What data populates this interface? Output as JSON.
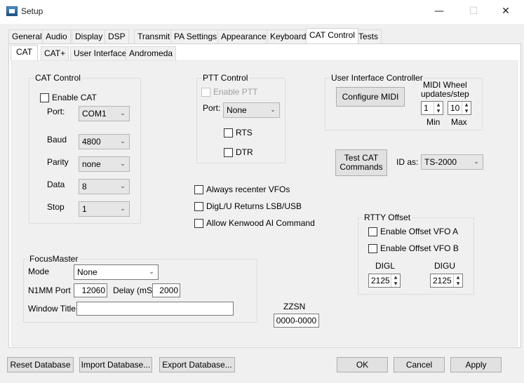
{
  "window": {
    "title": "Setup",
    "minimize_icon": "—",
    "maximize_icon": "☐",
    "close_icon": "✕"
  },
  "tabs": [
    "General",
    "Audio",
    "Display",
    "DSP",
    "Transmit",
    "PA Settings",
    "Appearance",
    "Keyboard",
    "CAT Control",
    "Tests"
  ],
  "subtabs": [
    "CAT",
    "CAT+",
    "User Interface",
    "Andromeda"
  ],
  "cat_control": {
    "title": "CAT Control",
    "enable_label": "Enable CAT",
    "port_label": "Port:",
    "port_value": "COM1",
    "baud_label": "Baud",
    "baud_value": "4800",
    "parity_label": "Parity",
    "parity_value": "none",
    "data_label": "Data",
    "data_value": "8",
    "stop_label": "Stop",
    "stop_value": "1"
  },
  "ptt_control": {
    "title": "PTT Control",
    "enable_label": "Enable PTT",
    "port_label": "Port:",
    "port_value": "None",
    "rts_label": "RTS",
    "dtr_label": "DTR"
  },
  "ui_controller": {
    "title": "User Interface Controller",
    "configure_button": "Configure MIDI",
    "wheel_label_1": "MIDI  Wheel",
    "wheel_label_2": "updates/step",
    "min_value": "1",
    "max_value": "10",
    "min_label": "Min",
    "max_label": "Max"
  },
  "test_cat": {
    "button_line1": "Test CAT",
    "button_line2": "Commands",
    "id_as_label": "ID as:",
    "id_as_value": "TS-2000"
  },
  "options": {
    "always_recenter": "Always recenter VFOs",
    "digl_returns": "DigL/U Returns LSB/USB",
    "allow_kenwood": "Allow Kenwood AI Command"
  },
  "rtty": {
    "title": "RTTY Offset",
    "enable_a": "Enable Offset VFO A",
    "enable_b": "Enable Offset VFO B",
    "digl_label": "DIGL",
    "digu_label": "DIGU",
    "digl_value": "2125",
    "digu_value": "2125"
  },
  "focusmaster": {
    "title": "FocusMaster",
    "mode_label": "Mode",
    "mode_value": "None",
    "n1mm_label": "N1MM Port",
    "n1mm_value": "12060",
    "delay_label": "Delay (mS)",
    "delay_value": "2000",
    "window_title_label": "Window Title",
    "window_title_value": ""
  },
  "zzsn": {
    "label": "ZZSN",
    "value": "0000-0000"
  },
  "bottom": {
    "reset": "Reset Database",
    "import": "Import Database...",
    "export": "Export Database...",
    "ok": "OK",
    "cancel": "Cancel",
    "apply": "Apply"
  }
}
